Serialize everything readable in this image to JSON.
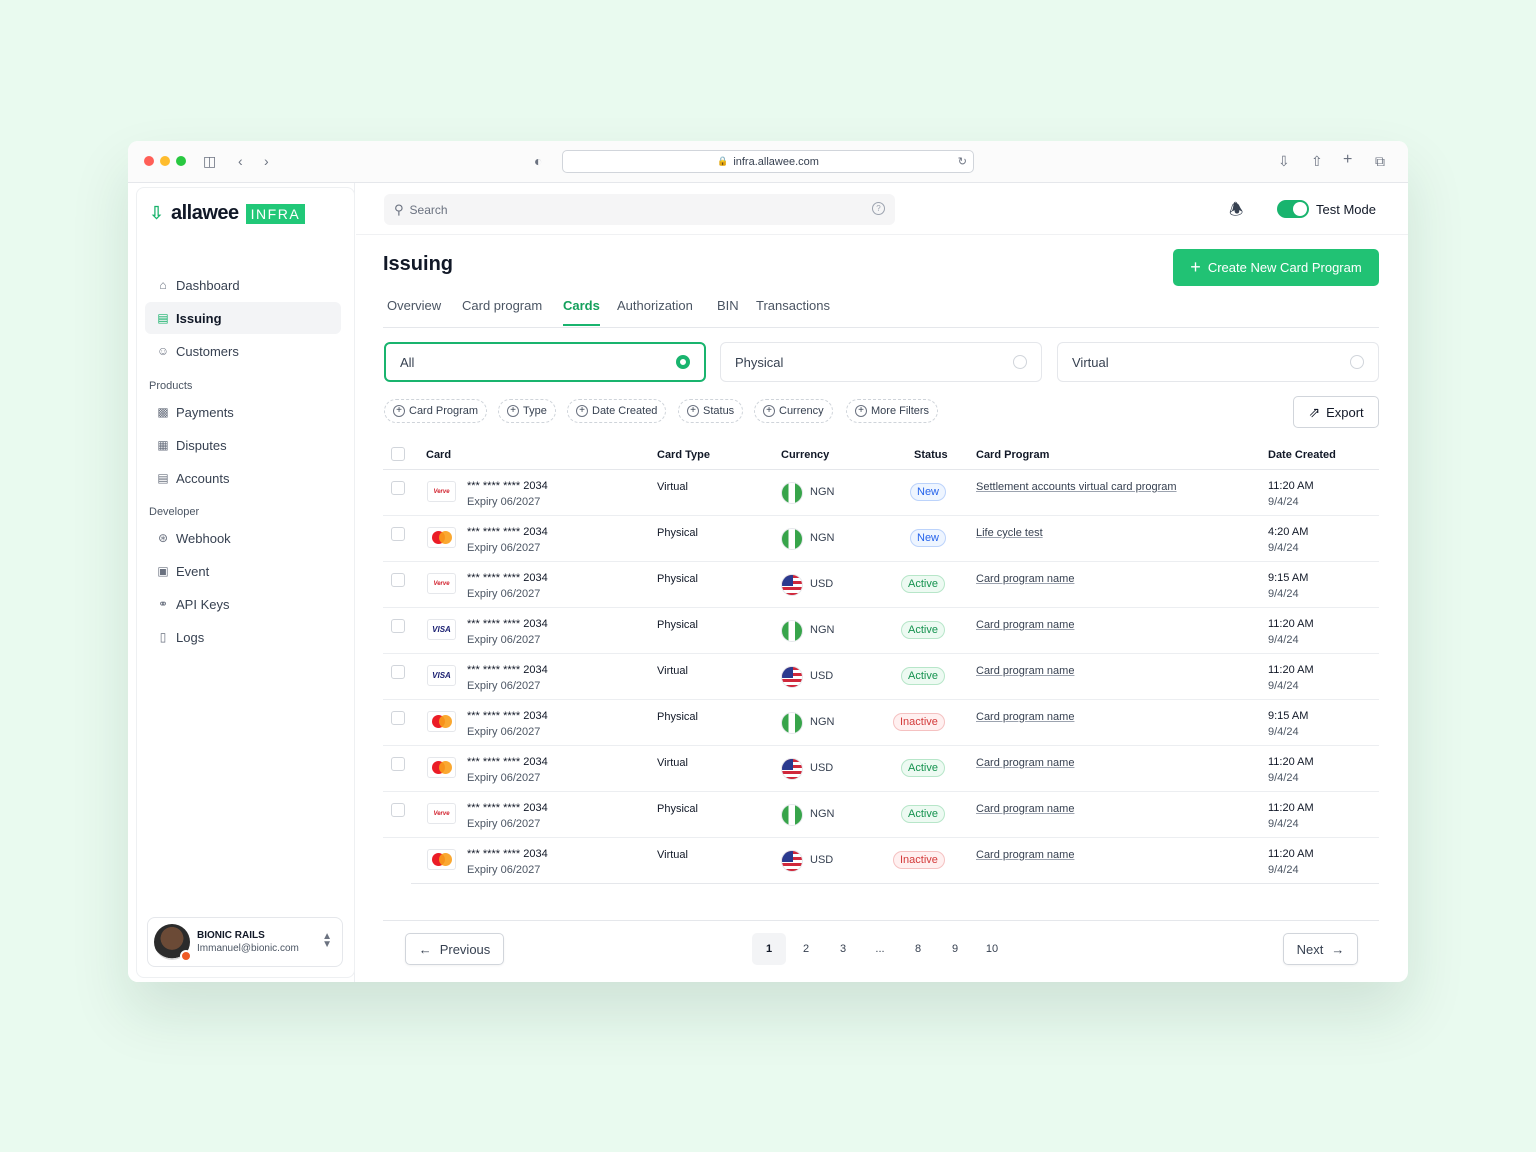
{
  "browser": {
    "url": "infra.allawee.com"
  },
  "brand": {
    "name": "allawee",
    "badge": "INFRA"
  },
  "sidebar": {
    "main_items": [
      {
        "label": "Dashboard",
        "icon": "home-icon"
      },
      {
        "label": "Issuing",
        "icon": "card-icon",
        "active": true
      },
      {
        "label": "Customers",
        "icon": "user-icon"
      }
    ],
    "products_title": "Products",
    "products": [
      {
        "label": "Payments",
        "icon": "payments-icon"
      },
      {
        "label": "Disputes",
        "icon": "ticket-icon"
      },
      {
        "label": "Accounts",
        "icon": "accounts-icon"
      }
    ],
    "developer_title": "Developer",
    "developer": [
      {
        "label": "Webhook",
        "icon": "webhook-icon"
      },
      {
        "label": "Event",
        "icon": "calendar-icon"
      },
      {
        "label": "API Keys",
        "icon": "key-icon"
      },
      {
        "label": "Logs",
        "icon": "book-icon"
      }
    ],
    "profile": {
      "name": "BIONIC RAILS",
      "email": "Immanuel@bionic.com"
    }
  },
  "topbar": {
    "search_placeholder": "Search",
    "test_mode_label": "Test Mode",
    "test_mode_on": true
  },
  "page": {
    "title": "Issuing",
    "create_button": "Create New Card Program"
  },
  "tabs": [
    {
      "label": "Overview"
    },
    {
      "label": "Card program"
    },
    {
      "label": "Cards",
      "active": true
    },
    {
      "label": "Authorization"
    },
    {
      "label": "BIN"
    },
    {
      "label": "Transactions"
    }
  ],
  "segments": [
    {
      "label": "All",
      "selected": true
    },
    {
      "label": "Physical",
      "selected": false
    },
    {
      "label": "Virtual",
      "selected": false
    }
  ],
  "filters": [
    "Card Program",
    "Type",
    "Date Created",
    "Status",
    "Currency",
    "More Filters"
  ],
  "export_label": "Export",
  "table": {
    "headers": {
      "card": "Card",
      "card_type": "Card Type",
      "currency": "Currency",
      "status": "Status",
      "card_program": "Card Program",
      "date_created": "Date Created"
    },
    "rows": [
      {
        "brand": "verve",
        "number": "*** **** **** 2034",
        "expiry": "Expiry 06/2027",
        "type": "Virtual",
        "currency": "NGN",
        "status": "New",
        "program": "Settlement accounts virtual card program",
        "time": "11:20 AM",
        "date": "9/4/24"
      },
      {
        "brand": "mastercard",
        "number": "*** **** **** 2034",
        "expiry": "Expiry 06/2027",
        "type": "Physical",
        "currency": "NGN",
        "status": "New",
        "program": "Life cycle test",
        "time": "4:20 AM",
        "date": "9/4/24"
      },
      {
        "brand": "verve",
        "number": "*** **** **** 2034",
        "expiry": "Expiry 06/2027",
        "type": "Physical",
        "currency": "USD",
        "status": "Active",
        "program": "Card program name",
        "time": "9:15 AM",
        "date": "9/4/24"
      },
      {
        "brand": "visa",
        "number": "*** **** **** 2034",
        "expiry": "Expiry 06/2027",
        "type": "Physical",
        "currency": "NGN",
        "status": "Active",
        "program": "Card program name",
        "time": "11:20 AM",
        "date": "9/4/24"
      },
      {
        "brand": "visa",
        "number": "*** **** **** 2034",
        "expiry": "Expiry 06/2027",
        "type": "Virtual",
        "currency": "USD",
        "status": "Active",
        "program": "Card program name",
        "time": "11:20 AM",
        "date": "9/4/24"
      },
      {
        "brand": "mastercard",
        "number": "*** **** **** 2034",
        "expiry": "Expiry 06/2027",
        "type": "Physical",
        "currency": "NGN",
        "status": "Inactive",
        "program": "Card program name",
        "time": "9:15 AM",
        "date": "9/4/24"
      },
      {
        "brand": "mastercard",
        "number": "*** **** **** 2034",
        "expiry": "Expiry 06/2027",
        "type": "Virtual",
        "currency": "USD",
        "status": "Active",
        "program": "Card program name",
        "time": "11:20 AM",
        "date": "9/4/24"
      },
      {
        "brand": "verve",
        "number": "*** **** **** 2034",
        "expiry": "Expiry 06/2027",
        "type": "Physical",
        "currency": "NGN",
        "status": "Active",
        "program": "Card program name",
        "time": "11:20 AM",
        "date": "9/4/24"
      },
      {
        "brand": "mastercard",
        "number": "*** **** **** 2034",
        "expiry": "Expiry 06/2027",
        "type": "Virtual",
        "currency": "USD",
        "status": "Inactive",
        "program": "Card program name",
        "time": "11:20 AM",
        "date": "9/4/24"
      }
    ]
  },
  "pagination": {
    "previous": "Previous",
    "next": "Next",
    "pages": [
      "1",
      "2",
      "3",
      "...",
      "8",
      "9",
      "10"
    ],
    "current": "1"
  },
  "colors": {
    "accent": "#21c274",
    "background": "#e9faef"
  }
}
